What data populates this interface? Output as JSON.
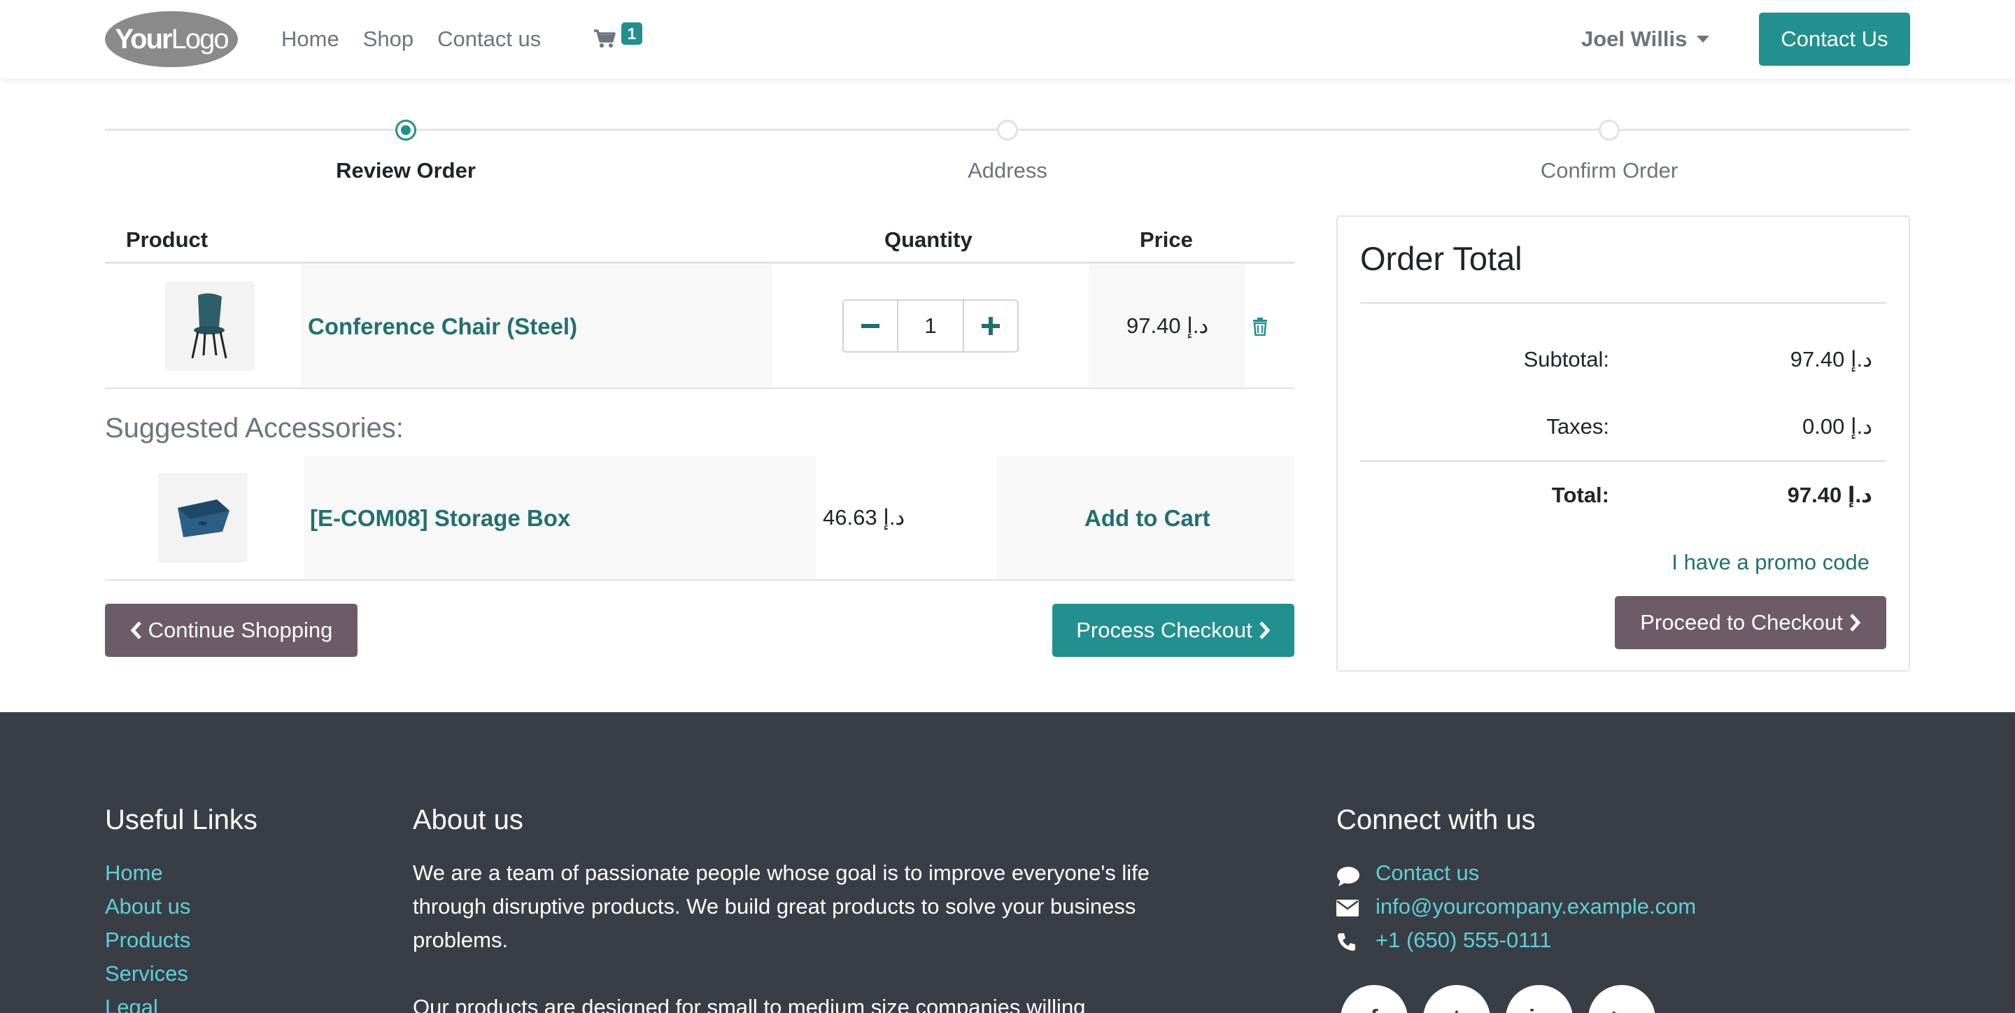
{
  "header": {
    "logo_text_bold": "Your",
    "logo_text_light": "Logo",
    "nav": [
      "Home",
      "Shop",
      "Contact us"
    ],
    "cart_count": "1",
    "user_name": "Joel Willis",
    "contact_button": "Contact Us"
  },
  "progress": {
    "steps": [
      "Review Order",
      "Address",
      "Confirm Order"
    ],
    "active_step": "Review Order"
  },
  "cart": {
    "headers": {
      "product": "Product",
      "quantity": "Quantity",
      "price": "Price"
    },
    "items": [
      {
        "name": "Conference Chair (Steel)",
        "quantity": "1",
        "price": "97.40 د.إ"
      }
    ]
  },
  "accessories": {
    "title": "Suggested Accessories:",
    "items": [
      {
        "name": "[E-COM08] Storage Box",
        "price": "46.63 د.إ",
        "action": "Add to Cart"
      }
    ]
  },
  "actions": {
    "continue_shopping": "Continue Shopping",
    "process_checkout": "Process Checkout"
  },
  "order_total": {
    "title": "Order Total",
    "subtotal_label": "Subtotal:",
    "subtotal_value": "97.40 د.إ",
    "taxes_label": "Taxes:",
    "taxes_value": "0.00 د.إ",
    "total_label": "Total:",
    "total_value": "97.40 د.إ",
    "promo_link": "I have a promo code",
    "proceed_button": "Proceed to Checkout"
  },
  "footer": {
    "useful_links_title": "Useful Links",
    "useful_links": [
      "Home",
      "About us",
      "Products",
      "Services",
      "Legal"
    ],
    "about_title": "About us",
    "about_paragraph_1": "We are a team of passionate people whose goal is to improve everyone's life through disruptive products. We build great products to solve your business problems.",
    "about_paragraph_2": "Our products are designed for small to medium size companies willing",
    "connect_title": "Connect with us",
    "contact_link": "Contact us",
    "email_link": "info@yourcompany.example.com",
    "phone_link": "+1 (650) 555-0111",
    "social_icons": [
      "facebook-icon",
      "twitter-icon",
      "linkedin-icon",
      "youtube-icon"
    ]
  },
  "colors": {
    "primary": "#21908e",
    "secondary": "#6d5b68",
    "footer_bg": "#393e46",
    "footer_link": "#5ed1d6"
  }
}
